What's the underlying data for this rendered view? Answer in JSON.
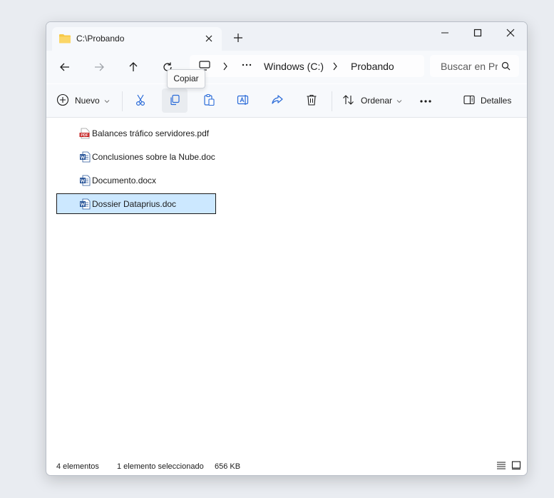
{
  "tab": {
    "title": "C:\\Probando"
  },
  "breadcrumb": {
    "items": [
      "Windows (C:)",
      "Probando"
    ]
  },
  "search": {
    "placeholder": "Buscar en Probando"
  },
  "toolbar": {
    "new_label": "Nuevo",
    "sort_label": "Ordenar",
    "details_label": "Detalles",
    "tooltip": "Copiar"
  },
  "files": [
    {
      "name": "Balances tráfico servidores.pdf",
      "type": "pdf"
    },
    {
      "name": "Conclusiones sobre la Nube.doc",
      "type": "word"
    },
    {
      "name": "Documento.docx",
      "type": "word"
    },
    {
      "name": "Dossier Dataprius.doc",
      "type": "word",
      "selected": true
    }
  ],
  "status": {
    "count": "4 elementos",
    "selection": "1 elemento seleccionado",
    "size": "656 KB"
  },
  "colors": {
    "selection_bg": "#cce8ff",
    "pdf_red": "#c62828",
    "word_blue": "#2b579a",
    "folder_yellow": "#f7c948"
  }
}
